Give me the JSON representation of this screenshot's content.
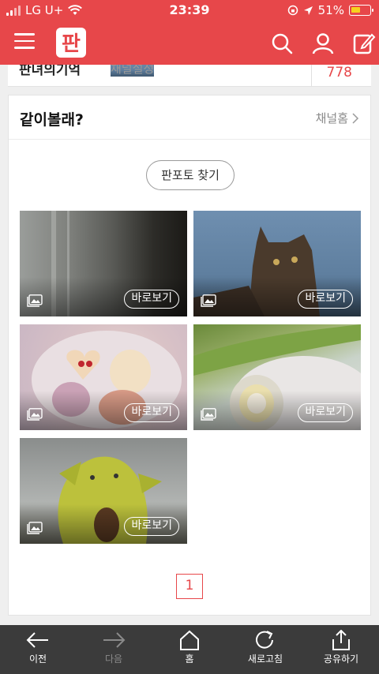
{
  "status_bar": {
    "carrier": "LG U+",
    "time": "23:39",
    "battery_percent": "51%",
    "battery_level": 0.51
  },
  "header": {
    "logo_text": "판",
    "brand_color": "#e7474a"
  },
  "previous_card": {
    "channel_name": "판녀의기억",
    "settings_text": "채널설정",
    "count": "778"
  },
  "section": {
    "title": "같이볼래?",
    "channel_home_link": "채널홈",
    "find_button": "판포토 찾기"
  },
  "photos": [
    {
      "view_label": "바로보기",
      "icon": "image-icon"
    },
    {
      "view_label": "바로보기",
      "icon": "image-icon"
    },
    {
      "view_label": "바로보기",
      "icon": "image-icon"
    },
    {
      "view_label": "바로보기",
      "icon": "image-icon"
    },
    {
      "view_label": "바로보기",
      "icon": "image-icon"
    }
  ],
  "pagination": {
    "current_page": "1"
  },
  "toolbar": {
    "back": "이전",
    "next": "다음",
    "home": "홈",
    "refresh": "새로고침",
    "share": "공유하기"
  }
}
